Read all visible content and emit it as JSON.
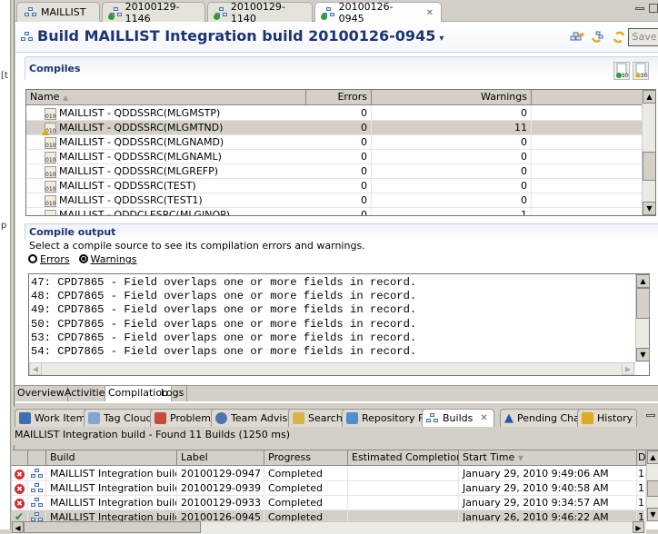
{
  "left_strip": {
    "chars": [
      "[t",
      "p"
    ]
  },
  "editor_tabs": [
    {
      "label": "MAILLIST",
      "icon": "build-definition-icon",
      "active": false
    },
    {
      "label": "20100129-1146",
      "icon": "build-result-icon",
      "active": false
    },
    {
      "label": "20100129-1140",
      "icon": "build-result-icon",
      "active": false
    },
    {
      "label": "20100126-0945",
      "icon": "build-result-icon",
      "active": true,
      "close": "✕"
    }
  ],
  "editor": {
    "title": "Build MAILLIST Integration build 20100126-0945",
    "title_dropdown": "▾",
    "toolbar": {
      "save_label": "Save"
    },
    "compiles": {
      "section_title": "Compiles",
      "columns": [
        "Name",
        "Errors",
        "Warnings"
      ],
      "sort_indicator": "▲",
      "rows": [
        {
          "name": "MAILLIST - QDDSSRC(MLGMSTP)",
          "errors": "0",
          "warnings": "0",
          "warn_icon": false,
          "selected": false
        },
        {
          "name": "MAILLIST - QDDSSRC(MLGMTND)",
          "errors": "0",
          "warnings": "11",
          "warn_icon": true,
          "selected": true
        },
        {
          "name": "MAILLIST - QDDSSRC(MLGNAMD)",
          "errors": "0",
          "warnings": "0",
          "warn_icon": false,
          "selected": false
        },
        {
          "name": "MAILLIST - QDDSSRC(MLGNAML)",
          "errors": "0",
          "warnings": "0",
          "warn_icon": false,
          "selected": false
        },
        {
          "name": "MAILLIST - QDDSSRC(MLGREFP)",
          "errors": "0",
          "warnings": "0",
          "warn_icon": false,
          "selected": false
        },
        {
          "name": "MAILLIST - QDDSSRC(TEST)",
          "errors": "0",
          "warnings": "0",
          "warn_icon": false,
          "selected": false
        },
        {
          "name": "MAILLIST - QDDSSRC(TEST1)",
          "errors": "0",
          "warnings": "0",
          "warn_icon": false,
          "selected": false
        },
        {
          "name": "MAILLIST - QDDCLESRC(MLGINQP)",
          "errors": "0",
          "warnings": "1",
          "warn_icon": false,
          "selected": false
        }
      ]
    },
    "compile_output": {
      "section_title": "Compile output",
      "description": "Select a compile source to see its compilation errors and warnings.",
      "radio_errors": "Errors",
      "radio_warnings": "Warnings",
      "selected_radio": "warnings",
      "lines": [
        "47: CPD7865 - Field overlaps one or more fields in record.",
        "48: CPD7865 - Field overlaps one or more fields in record.",
        "49: CPD7865 - Field overlaps one or more fields in record.",
        "50: CPD7865 - Field overlaps one or more fields in record.",
        "53: CPD7865 - Field overlaps one or more fields in record.",
        "54: CPD7865 - Field overlaps one or more fields in record."
      ]
    },
    "bottom_tabs": [
      "Overview",
      "Activities",
      "Compilation",
      "Logs"
    ],
    "active_bottom_tab": "Compilation"
  },
  "view_tabs": [
    {
      "label": "Work Items",
      "color": "#3d6fb5"
    },
    {
      "label": "Tag Cloud",
      "color": "#7fa6d6"
    },
    {
      "label": "Problems",
      "color": "#c94a3a"
    },
    {
      "label": "Team Adviso",
      "color": "#4a74b0"
    },
    {
      "label": "Search",
      "color": "#d8b24a"
    },
    {
      "label": "Repository Fi",
      "color": "#4f8fd0"
    },
    {
      "label": "Builds",
      "color": "#4a6ea8",
      "active": true,
      "close": "✕"
    },
    {
      "label": "Pending Cha",
      "color": "#2356b0"
    },
    {
      "label": "History",
      "color": "#e0a820"
    }
  ],
  "builds": {
    "status": "MAILLIST Integration build - Found 11 Builds (1250 ms)",
    "columns": [
      "",
      "",
      "Build",
      "Label",
      "Progress",
      "Estimated Completion",
      "Start Time",
      "Du"
    ],
    "sort_indicator": "▼",
    "rows": [
      {
        "status": "error",
        "build": "MAILLIST Integration build",
        "label": "20100129-0947",
        "progress": "Completed",
        "estimated": "",
        "start": "January 29, 2010 9:49:06 AM",
        "duration": "1",
        "selected": false
      },
      {
        "status": "error",
        "build": "MAILLIST Integration build",
        "label": "20100129-0939",
        "progress": "Completed",
        "estimated": "",
        "start": "January 29, 2010 9:40:58 AM",
        "duration": "1",
        "selected": false
      },
      {
        "status": "error",
        "build": "MAILLIST Integration build",
        "label": "20100129-0933",
        "progress": "Completed",
        "estimated": "",
        "start": "January 29, 2010 9:34:57 AM",
        "duration": "1",
        "selected": false
      },
      {
        "status": "ok",
        "build": "MAILLIST Integration build",
        "label": "20100126-0945",
        "progress": "Completed",
        "estimated": "",
        "start": "January 26, 2010 9:46:22 AM",
        "duration": "1",
        "selected": true
      }
    ]
  },
  "icons": {
    "error": "✖",
    "ok": "✔",
    "scroll_up": "▲",
    "scroll_down": "▼",
    "scroll_left": "◀",
    "scroll_right": "▶"
  }
}
